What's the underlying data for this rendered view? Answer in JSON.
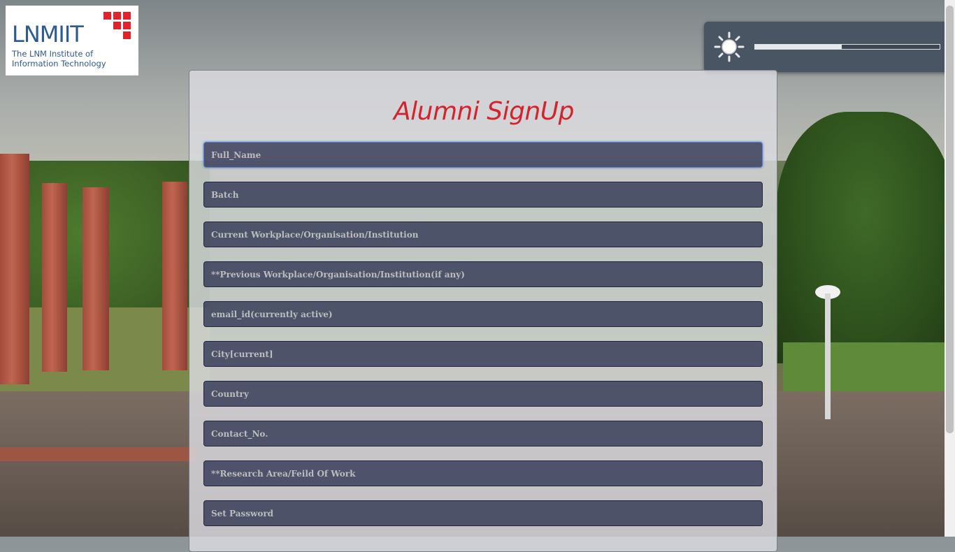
{
  "logo": {
    "name": "LNMIIT",
    "line1": "The LNM Institute of",
    "line2": "Information Technology"
  },
  "brightness": {
    "icon": "sun-icon",
    "level_fraction": 0.47
  },
  "form": {
    "title": "Alumni SignUp",
    "fields": [
      {
        "placeholder": "Full_Name"
      },
      {
        "placeholder": "Batch"
      },
      {
        "placeholder": "Current Workplace/Organisation/Institution"
      },
      {
        "placeholder": "**Previous Workplace/Organisation/Institution(if any)"
      },
      {
        "placeholder": "email_id(currently active)"
      },
      {
        "placeholder": "City[current]"
      },
      {
        "placeholder": "Country"
      },
      {
        "placeholder": "Contact_No."
      },
      {
        "placeholder": "**Research Area/Feild Of Work"
      },
      {
        "placeholder": "Set Password"
      }
    ]
  },
  "colors": {
    "title": "#d2242c",
    "logo_text": "#2e5a93",
    "logo_grid": "#e3232b",
    "field_bg": "#2c3250",
    "widget_bg": "#4a5564"
  }
}
